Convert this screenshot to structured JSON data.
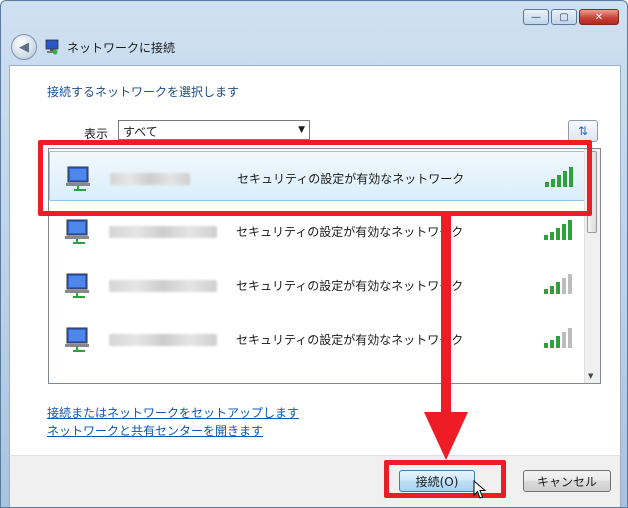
{
  "window": {
    "title": "ネットワークに接続",
    "controls": {
      "minimize": "—",
      "maximize": "▢",
      "close": "✕"
    }
  },
  "main": {
    "heading": "接続するネットワークを選択します",
    "filter": {
      "label": "表示",
      "selected": "すべて"
    },
    "networks": [
      {
        "security": "セキュリティの設定が有効なネットワーク",
        "signal_bars": 5,
        "selected": true
      },
      {
        "security": "セキュリティの設定が有効なネットワーク",
        "signal_bars": 5,
        "selected": false
      },
      {
        "security": "セキュリティの設定が有効なネットワーク",
        "signal_bars": 3,
        "selected": false
      },
      {
        "security": "セキュリティの設定が有効なネットワーク",
        "signal_bars": 3,
        "selected": false
      }
    ],
    "links": {
      "setup": "接続またはネットワークをセットアップします",
      "sharing_center": "ネットワークと共有センターを開きます"
    }
  },
  "footer": {
    "connect_label": "接続(O)",
    "cancel_label": "キャンセル"
  },
  "colors": {
    "annotation": "#ee1c24",
    "link": "#0d56b8",
    "heading": "#1f4c87"
  }
}
